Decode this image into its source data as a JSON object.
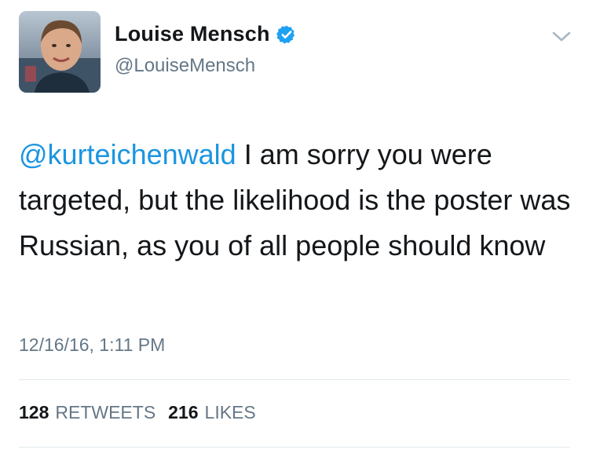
{
  "author": {
    "display_name": "Louise Mensch",
    "handle": "@LouiseMensch",
    "verified": true
  },
  "tweet": {
    "mention": "@kurteichenwald",
    "text": " I am sorry you were targeted, but the likelihood is the poster was Russian, as you of all people should know",
    "timestamp": "12/16/16, 1:11 PM"
  },
  "stats": {
    "retweets_count": "128",
    "retweets_label": "RETWEETS",
    "likes_count": "216",
    "likes_label": "LIKES"
  },
  "colors": {
    "link": "#1b95e0",
    "secondary_text": "#657786",
    "verified_badge": "#1da1f2"
  },
  "icons": {
    "verified": "verified-badge-icon",
    "menu": "chevron-down-icon"
  }
}
